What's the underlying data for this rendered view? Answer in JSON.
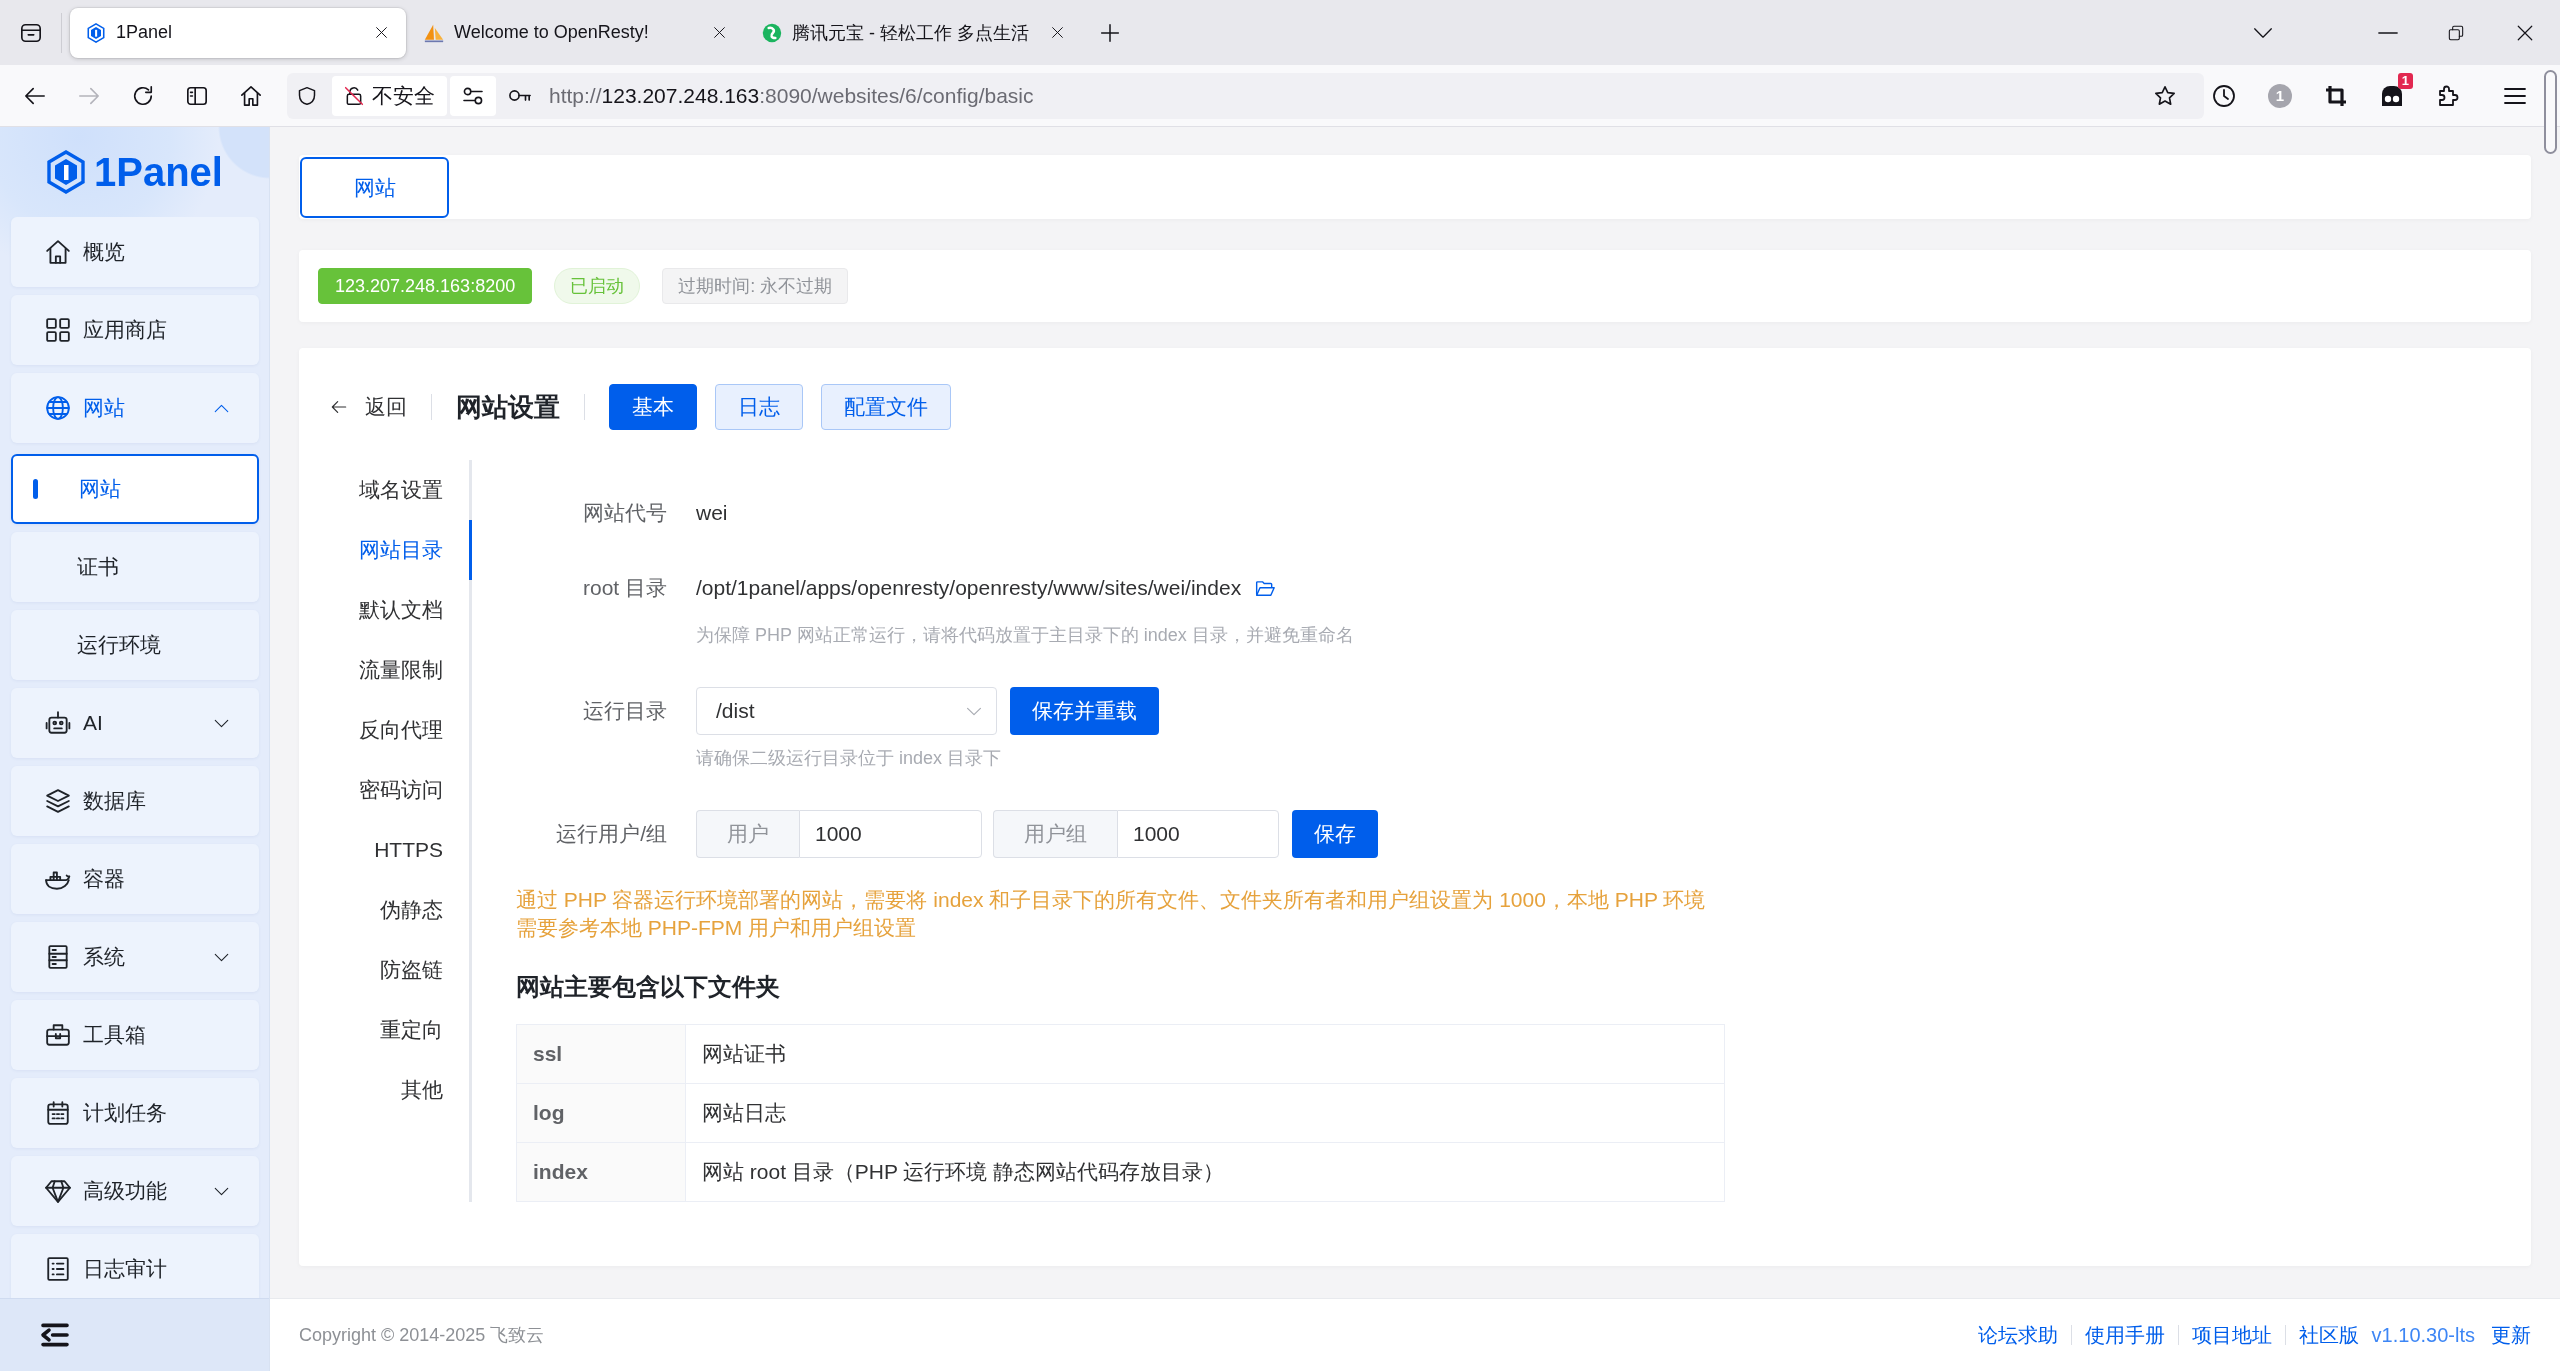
{
  "browser": {
    "tabs": [
      {
        "title": "1Panel",
        "selected": true
      },
      {
        "title": "Welcome to OpenResty!",
        "selected": false
      },
      {
        "title": "腾讯元宝 - 轻松工作 多点生活",
        "selected": false
      }
    ],
    "forward_disabled": true,
    "security_label": "不安全",
    "url": {
      "scheme": "http://",
      "host": "123.207.248.163",
      "path": ":8090/websites/6/config/basic"
    },
    "toolbar_counter": "1",
    "extension_badge": "1"
  },
  "sidebar": {
    "logo": "1Panel",
    "items": [
      {
        "kind": "link",
        "label": "概览",
        "selected": false
      },
      {
        "kind": "link",
        "label": "应用商店",
        "selected": false
      },
      {
        "kind": "group",
        "label": "网站",
        "selected": true,
        "expanded": true,
        "children": [
          {
            "label": "网站",
            "selected": true
          },
          {
            "label": "证书",
            "selected": false
          },
          {
            "label": "运行环境",
            "selected": false
          }
        ]
      },
      {
        "kind": "group",
        "label": "AI",
        "selected": false,
        "expanded": false
      },
      {
        "kind": "link",
        "label": "数据库",
        "selected": false
      },
      {
        "kind": "link",
        "label": "容器",
        "selected": false
      },
      {
        "kind": "group",
        "label": "系统",
        "selected": false,
        "expanded": false
      },
      {
        "kind": "link",
        "label": "工具箱",
        "selected": false
      },
      {
        "kind": "link",
        "label": "计划任务",
        "selected": false
      },
      {
        "kind": "group",
        "label": "高级功能",
        "selected": false,
        "expanded": false
      },
      {
        "kind": "link",
        "label": "日志审计",
        "selected": false
      }
    ]
  },
  "page_tabs": [
    {
      "label": "网站",
      "selected": true
    }
  ],
  "site_tags": [
    {
      "kind": "address",
      "text": "123.207.248.163:8200"
    },
    {
      "kind": "status",
      "text": "已启动"
    },
    {
      "kind": "info",
      "text": "过期时间: 永不过期"
    }
  ],
  "settings": {
    "back": "返回",
    "title": "网站设置",
    "tabs": [
      {
        "label": "基本",
        "selected": true
      },
      {
        "label": "日志",
        "selected": false
      },
      {
        "label": "配置文件",
        "selected": false
      }
    ],
    "menu": [
      {
        "label": "域名设置",
        "selected": false
      },
      {
        "label": "网站目录",
        "selected": true
      },
      {
        "label": "默认文档",
        "selected": false
      },
      {
        "label": "流量限制",
        "selected": false
      },
      {
        "label": "反向代理",
        "selected": false
      },
      {
        "label": "密码访问",
        "selected": false
      },
      {
        "label": "HTTPS",
        "selected": false
      },
      {
        "label": "伪静态",
        "selected": false
      },
      {
        "label": "防盗链",
        "selected": false
      },
      {
        "label": "重定向",
        "selected": false
      },
      {
        "label": "其他",
        "selected": false
      }
    ],
    "fields": [
      {
        "kind": "text",
        "label": "网站代号",
        "value": "wei"
      },
      {
        "kind": "path",
        "label": "root 目录",
        "value": "/opt/1panel/apps/openresty/openresty/www/sites/wei/index",
        "hint": "为保障 PHP 网站正常运行，请将代码放置于主目录下的 index 目录，并避免重命名"
      },
      {
        "kind": "select",
        "label": "运行目录",
        "value": "/dist",
        "button": "保存并重载",
        "hint": "请确保二级运行目录位于 index 目录下"
      },
      {
        "kind": "user_group",
        "label": "运行用户/组",
        "user_label": "用户",
        "user": "1000",
        "group_label": "用户组",
        "group": "1000",
        "button": "保存"
      }
    ],
    "warning": "通过 PHP 容器运行环境部署的网站，需要将 index 和子目录下的所有文件、文件夹所有者和用户组设置为 1000，本地 PHP 环境需要参考本地 PHP-FPM 用户和用户组设置",
    "folders": {
      "title": "网站主要包含以下文件夹",
      "rows": [
        {
          "name": "ssl",
          "description": "网站证书"
        },
        {
          "name": "log",
          "description": "网站日志"
        },
        {
          "name": "index",
          "description": "网站 root 目录（PHP 运行环境 静态网站代码存放目录）"
        }
      ]
    }
  },
  "footer": {
    "copyright": "Copyright © 2014-2025 飞致云",
    "links": [
      "论坛求助",
      "使用手册",
      "项目地址",
      "社区版"
    ],
    "version": "v1.10.30-lts",
    "update": "更新"
  }
}
